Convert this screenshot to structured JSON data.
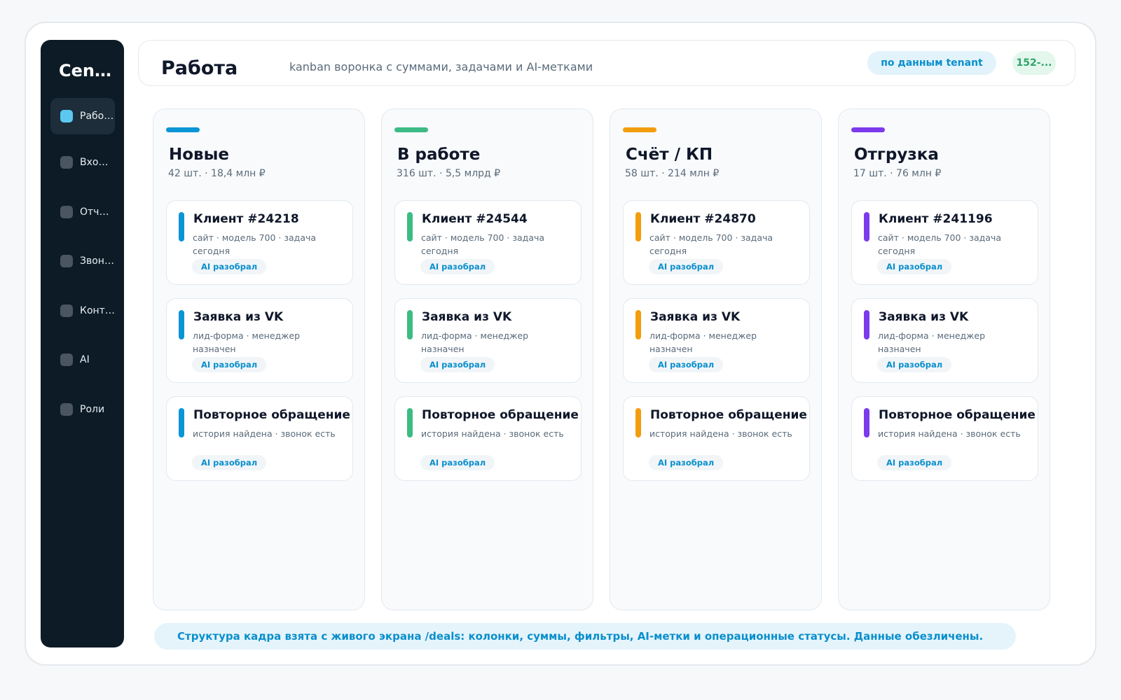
{
  "brand": "Cent...",
  "nav": [
    {
      "label": "Работа",
      "active": true
    },
    {
      "label": "Входящ...",
      "active": false
    },
    {
      "label": "Отчёты",
      "active": false
    },
    {
      "label": "Звонки",
      "active": false
    },
    {
      "label": "Контент",
      "active": false
    },
    {
      "label": "AI",
      "active": false
    },
    {
      "label": "Роли",
      "active": false
    }
  ],
  "header": {
    "title": "Работа",
    "subtitle": "kanban воронка с суммами, задачами и AI-метками",
    "tenant_badge": "по данным tenant",
    "count_badge": "152-..."
  },
  "columns": [
    {
      "title": "Новые",
      "meta": "42 шт. · 18,4 млн ₽",
      "color": "#0a95d6",
      "cards": [
        {
          "title": "Клиент #24218",
          "sub": "сайт · модель 700 · задача сегодня",
          "tag": "AI разобрал"
        },
        {
          "title": "Заявка из VK",
          "sub": "лид-форма · менеджер назначен",
          "tag": "AI разобрал"
        },
        {
          "title": "Повторное обращение",
          "sub": "история найдена · звонок есть",
          "tag": "AI разобрал"
        }
      ]
    },
    {
      "title": "В работе",
      "meta": "316 шт. · 5,5 млрд ₽",
      "color": "#3dbb84",
      "cards": [
        {
          "title": "Клиент #24544",
          "sub": "сайт · модель 700 · задача сегодня",
          "tag": "AI разобрал"
        },
        {
          "title": "Заявка из VK",
          "sub": "лид-форма · менеджер назначен",
          "tag": "AI разобрал"
        },
        {
          "title": "Повторное обращение",
          "sub": "история найдена · звонок есть",
          "tag": "AI разобрал"
        }
      ]
    },
    {
      "title": "Счёт / КП",
      "meta": "58 шт. · 214 млн ₽",
      "color": "#f29d0e",
      "cards": [
        {
          "title": "Клиент #24870",
          "sub": "сайт · модель 700 · задача сегодня",
          "tag": "AI разобрал"
        },
        {
          "title": "Заявка из VK",
          "sub": "лид-форма · менеджер назначен",
          "tag": "AI разобрал"
        },
        {
          "title": "Повторное обращение",
          "sub": "история найдена · звонок есть",
          "tag": "AI разобрал"
        }
      ]
    },
    {
      "title": "Отгрузка",
      "meta": "17 шт. · 76 млн ₽",
      "color": "#7c3aed",
      "cards": [
        {
          "title": "Клиент #241196",
          "sub": "сайт · модель 700 · задача сегодня",
          "tag": "AI разобрал"
        },
        {
          "title": "Заявка из VK",
          "sub": "лид-форма · менеджер назначен",
          "tag": "AI разобрал"
        },
        {
          "title": "Повторное обращение",
          "sub": "история найдена · звонок есть",
          "tag": "AI разобрал"
        }
      ]
    }
  ],
  "footer_note": "Структура кадра взята с живого экрана /deals: колонки, суммы, фильтры, AI-метки и операционные статусы. Данные обезличены."
}
